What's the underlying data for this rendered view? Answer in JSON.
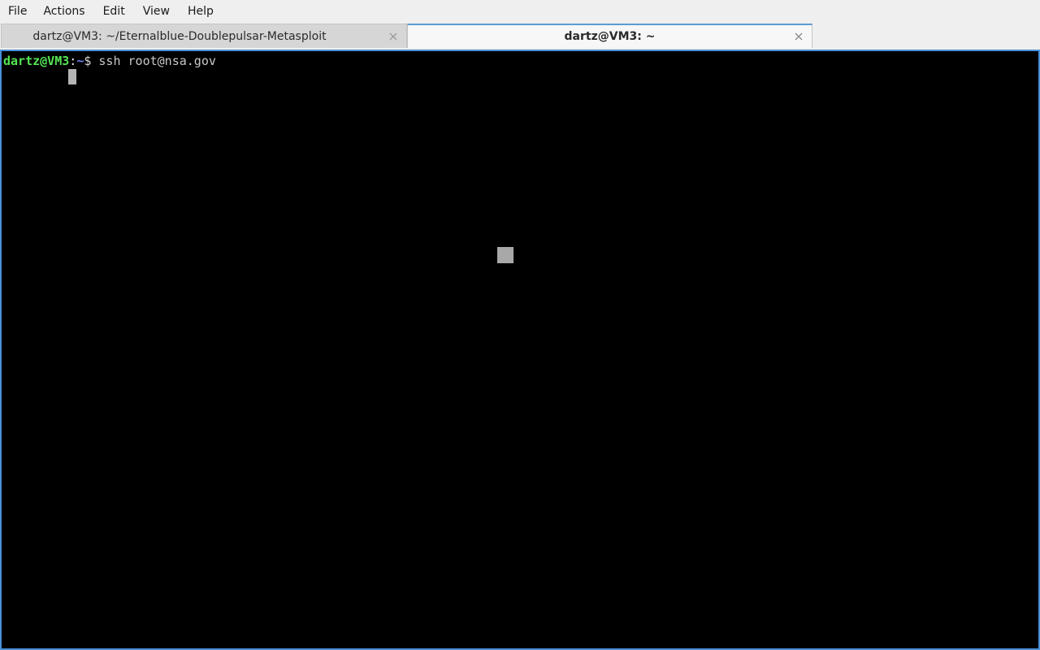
{
  "menubar": {
    "items": [
      {
        "label": "File"
      },
      {
        "label": "Actions"
      },
      {
        "label": "Edit"
      },
      {
        "label": "View"
      },
      {
        "label": "Help"
      }
    ]
  },
  "tabs": [
    {
      "label": "dartz@VM3: ~/Eternalblue-Doublepulsar-Metasploit",
      "active": false,
      "close_icon": "close-icon"
    },
    {
      "label": "dartz@VM3: ~",
      "active": true,
      "close_icon": "close-icon"
    }
  ],
  "terminal": {
    "prompt_user": "dartz@VM3",
    "prompt_colon": ":",
    "prompt_path": "~",
    "prompt_dollar": "$ ",
    "command": "ssh root@nsa.gov",
    "colors": {
      "background": "#000000",
      "user": "#54e354",
      "path": "#6b82f0",
      "text": "#c8c8c8",
      "border": "#4a90d9"
    }
  }
}
